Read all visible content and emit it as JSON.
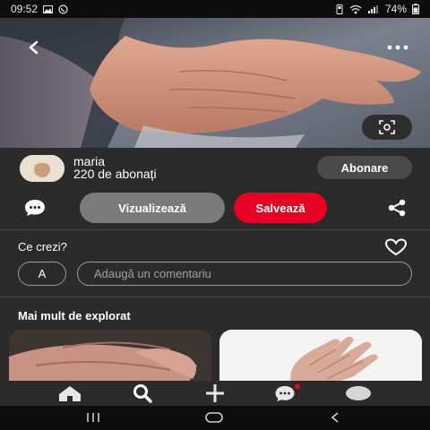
{
  "status_bar": {
    "time": "09:52",
    "battery": "74%"
  },
  "pin": {
    "user_name": "maria",
    "followers": "220 de abonați",
    "follow_label": "Abonare",
    "view_label": "Vizualizează",
    "save_label": "Salvează"
  },
  "comments": {
    "title": "Ce crezi?",
    "avatar_initial": "A",
    "placeholder": "Adaugă un comentariu"
  },
  "explore": {
    "title": "Mai mult de explorat"
  },
  "colors": {
    "background": "#2b2b2b",
    "save_red": "#e60023",
    "view_grey": "#7a7a7a",
    "follow_grey": "#4a4a4a"
  }
}
